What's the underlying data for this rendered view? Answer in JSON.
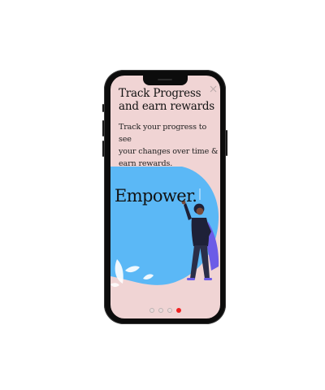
{
  "onboarding": {
    "title": "Track Progress\nand earn rewards",
    "description": "Track your progress to see\nyour changes over time &\nearn rewards.",
    "headline": "Empower.",
    "pager": {
      "total": 4,
      "active_index": 3
    }
  },
  "icons": {
    "close": "close-icon"
  },
  "colors": {
    "screen_background": "#f0d4d4",
    "illustration_blob": "#5bb8f6",
    "cape": "#6c5ce7",
    "active_dot": "#f02020"
  }
}
